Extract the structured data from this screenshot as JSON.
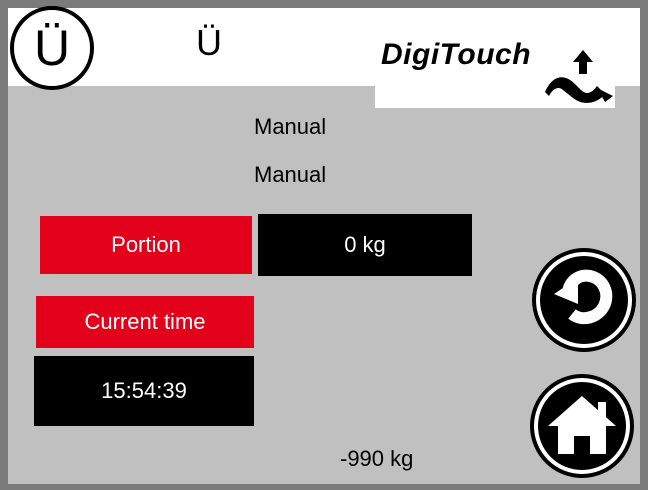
{
  "header": {
    "badge_letter": "Ü",
    "title_letter": "Ü",
    "logo_text": "DigiTouch",
    "logo_mark_icon": "hand-pointer-icon"
  },
  "status": {
    "mode_line_1": "Manual",
    "mode_line_2": "Manual"
  },
  "fields": {
    "portion_label": "Portion",
    "portion_value": "0 kg",
    "current_time_label": "Current time",
    "current_time_value": "15:54:39"
  },
  "footer": {
    "weight_value": "-990 kg"
  },
  "navigation": {
    "back_icon": "back-arrow-icon",
    "home_icon": "home-icon"
  },
  "colors": {
    "accent_red": "#e2001a",
    "panel_gray": "#c0c0c0",
    "value_black": "#000000",
    "frame_gray": "#7a7a7a"
  }
}
